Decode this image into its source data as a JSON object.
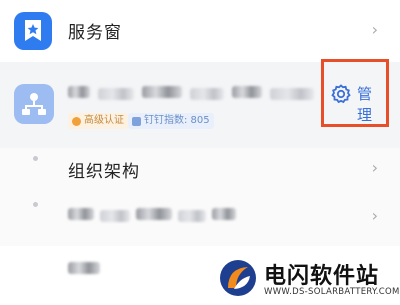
{
  "service_window": {
    "label": "服务窗",
    "icon": "bookmark-star-icon"
  },
  "organization": {
    "icon": "org-chart-icon",
    "badges": {
      "certification": "高级认证",
      "dingtalk_number": "钉钉指数: 805"
    },
    "manage_label": "管理",
    "manage_icon": "gear-icon",
    "highlight_color": "#e94e2a",
    "accent_color": "#3a6fd8"
  },
  "menu": {
    "org_structure_label": "组织架构"
  },
  "chevron": "›",
  "watermark": {
    "title": "电闪软件站",
    "url": "WWW.DS-SOLARBATTERY.COM"
  }
}
